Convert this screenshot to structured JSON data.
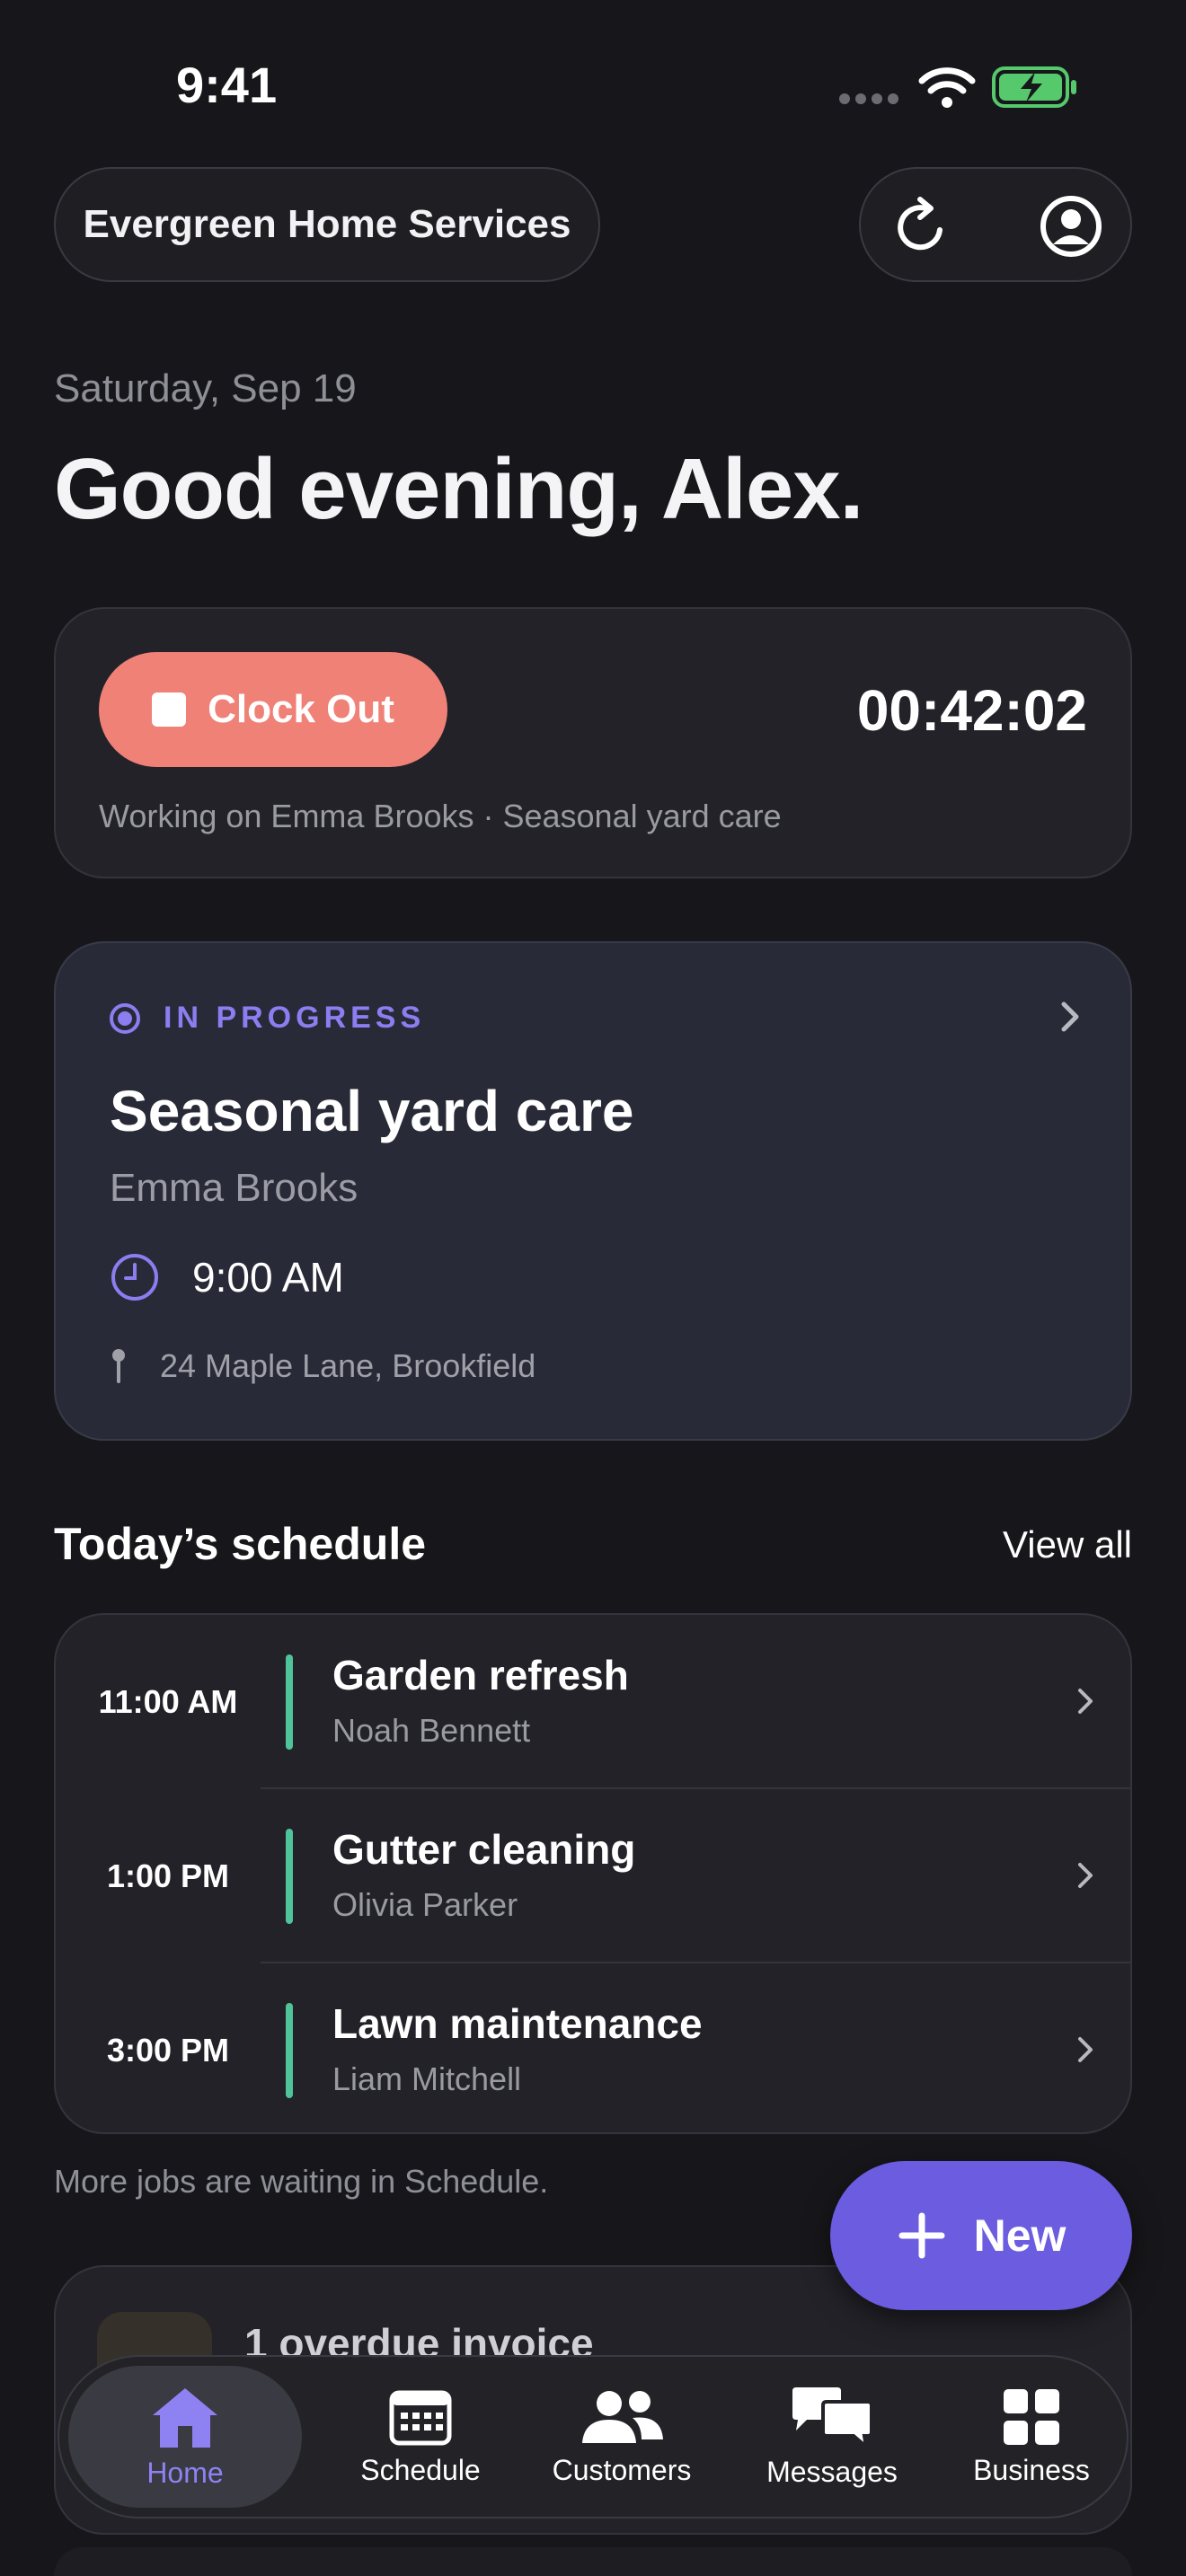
{
  "status_bar": {
    "time": "9:41"
  },
  "header": {
    "business_name": "Evergreen Home Services"
  },
  "greeting": {
    "date": "Saturday, Sep 19",
    "message": "Good evening, Alex."
  },
  "clock": {
    "button_label": "Clock Out",
    "timer": "00:42:02",
    "working_on": "Working on Emma Brooks · Seasonal yard care"
  },
  "current_job": {
    "status": "IN PROGRESS",
    "title": "Seasonal yard care",
    "customer": "Emma Brooks",
    "time": "9:00 AM",
    "address": "24 Maple Lane, Brookfield"
  },
  "schedule": {
    "title": "Today’s schedule",
    "view_all": "View all",
    "items": [
      {
        "time": "11:00 AM",
        "title": "Garden refresh",
        "customer": "Noah Bennett"
      },
      {
        "time": "1:00 PM",
        "title": "Gutter cleaning",
        "customer": "Olivia Parker"
      },
      {
        "time": "3:00 PM",
        "title": "Lawn maintenance",
        "customer": "Liam Mitchell"
      }
    ],
    "footer": "More jobs are waiting in Schedule."
  },
  "alerts": {
    "overdue": "1 overdue invoice"
  },
  "fab": {
    "label": "New"
  },
  "tabs": [
    {
      "label": "Home",
      "icon": "house-icon",
      "active": true
    },
    {
      "label": "Schedule",
      "icon": "calendar-icon"
    },
    {
      "label": "Customers",
      "icon": "people-icon"
    },
    {
      "label": "Messages",
      "icon": "chat-bubbles-icon"
    },
    {
      "label": "Business",
      "icon": "grid-icon"
    }
  ],
  "colors": {
    "accent": "#6b5ce0",
    "clock_out": "#ef8177",
    "schedule_bar": "#4fc39a",
    "background": "#17171b"
  }
}
